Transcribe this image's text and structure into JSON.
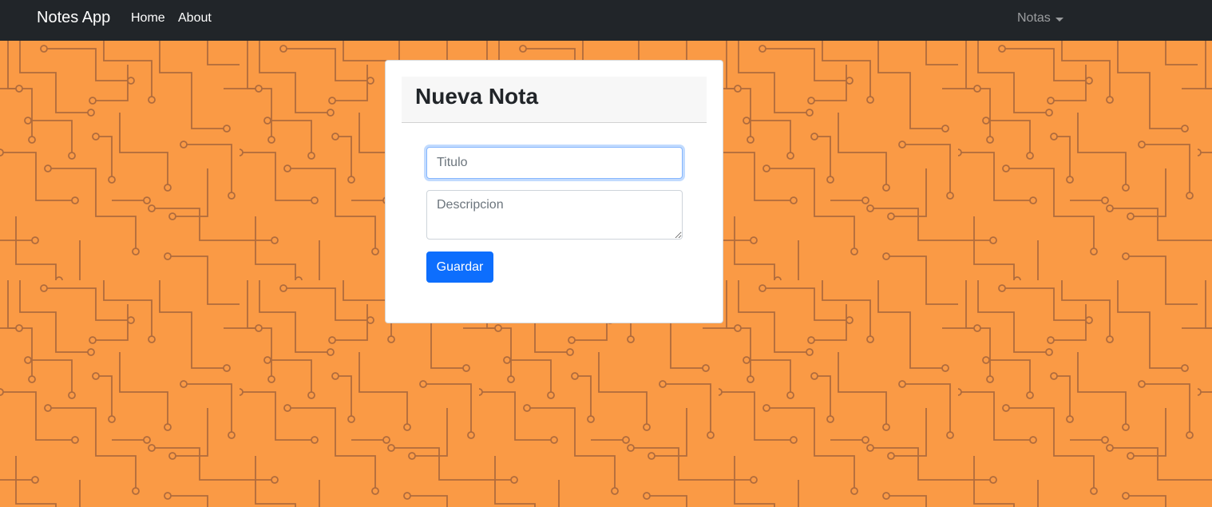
{
  "navbar": {
    "brand": "Notes App",
    "links": [
      "Home",
      "About"
    ],
    "dropdown_label": "Notas"
  },
  "form": {
    "title": "Nueva Nota",
    "title_field": {
      "value": "",
      "placeholder": "Titulo"
    },
    "description_field": {
      "value": "",
      "placeholder": "Descripcion"
    },
    "submit_label": "Guardar"
  },
  "colors": {
    "navbar_bg": "#212529",
    "background": "#fa9a45",
    "circuit_lines": "#b06b3c",
    "primary": "#0d6efd"
  },
  "icons": {
    "dropdown": "chevron-down-icon"
  }
}
